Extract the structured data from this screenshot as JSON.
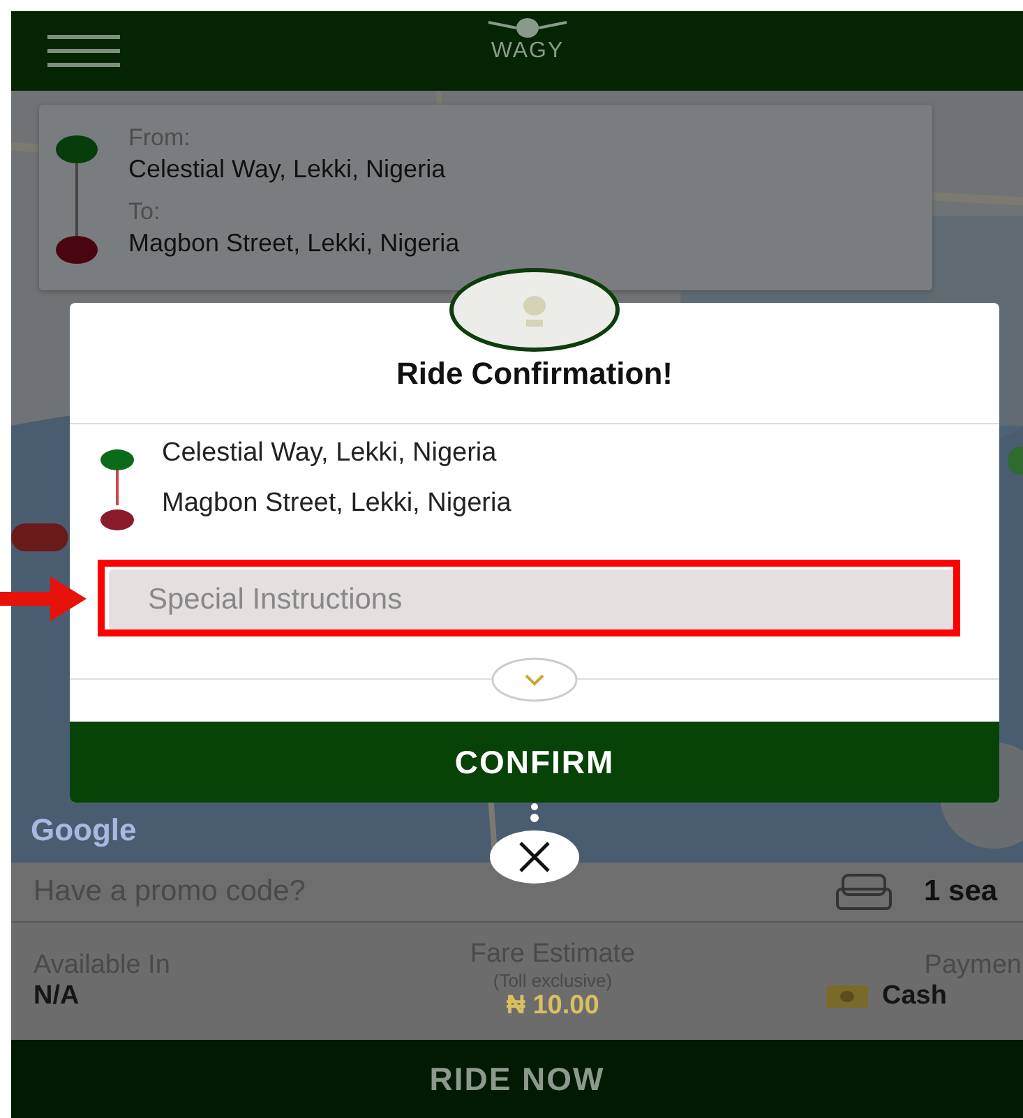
{
  "header": {
    "logo_text": "WAGY"
  },
  "trip": {
    "from_label": "From:",
    "from": "Celestial Way, Lekki, Nigeria",
    "to_label": "To:",
    "to": "Magbon Street, Lekki, Nigeria"
  },
  "map": {
    "attribution": "Google"
  },
  "modal": {
    "title": "Ride Confirmation!",
    "stops": [
      {
        "address": "Celestial Way, Lekki, Nigeria",
        "color": "#0b6b1a"
      },
      {
        "address": "Magbon Street, Lekki, Nigeria",
        "color": "#8b1a2b"
      }
    ],
    "instructions": {
      "placeholder": "Special Instructions"
    },
    "confirm": "CONFIRM"
  },
  "promo": {
    "placeholder": "Have a promo code?",
    "seats": "1 sea"
  },
  "summary": {
    "available_label": "Available In",
    "available": "N/A",
    "fare_label": "Fare Estimate",
    "fare_note": "(Toll exclusive)",
    "fare": "₦ 10.00",
    "payment_label": "Paymen",
    "payment": "Cash"
  },
  "ride_button": "RIDE NOW"
}
